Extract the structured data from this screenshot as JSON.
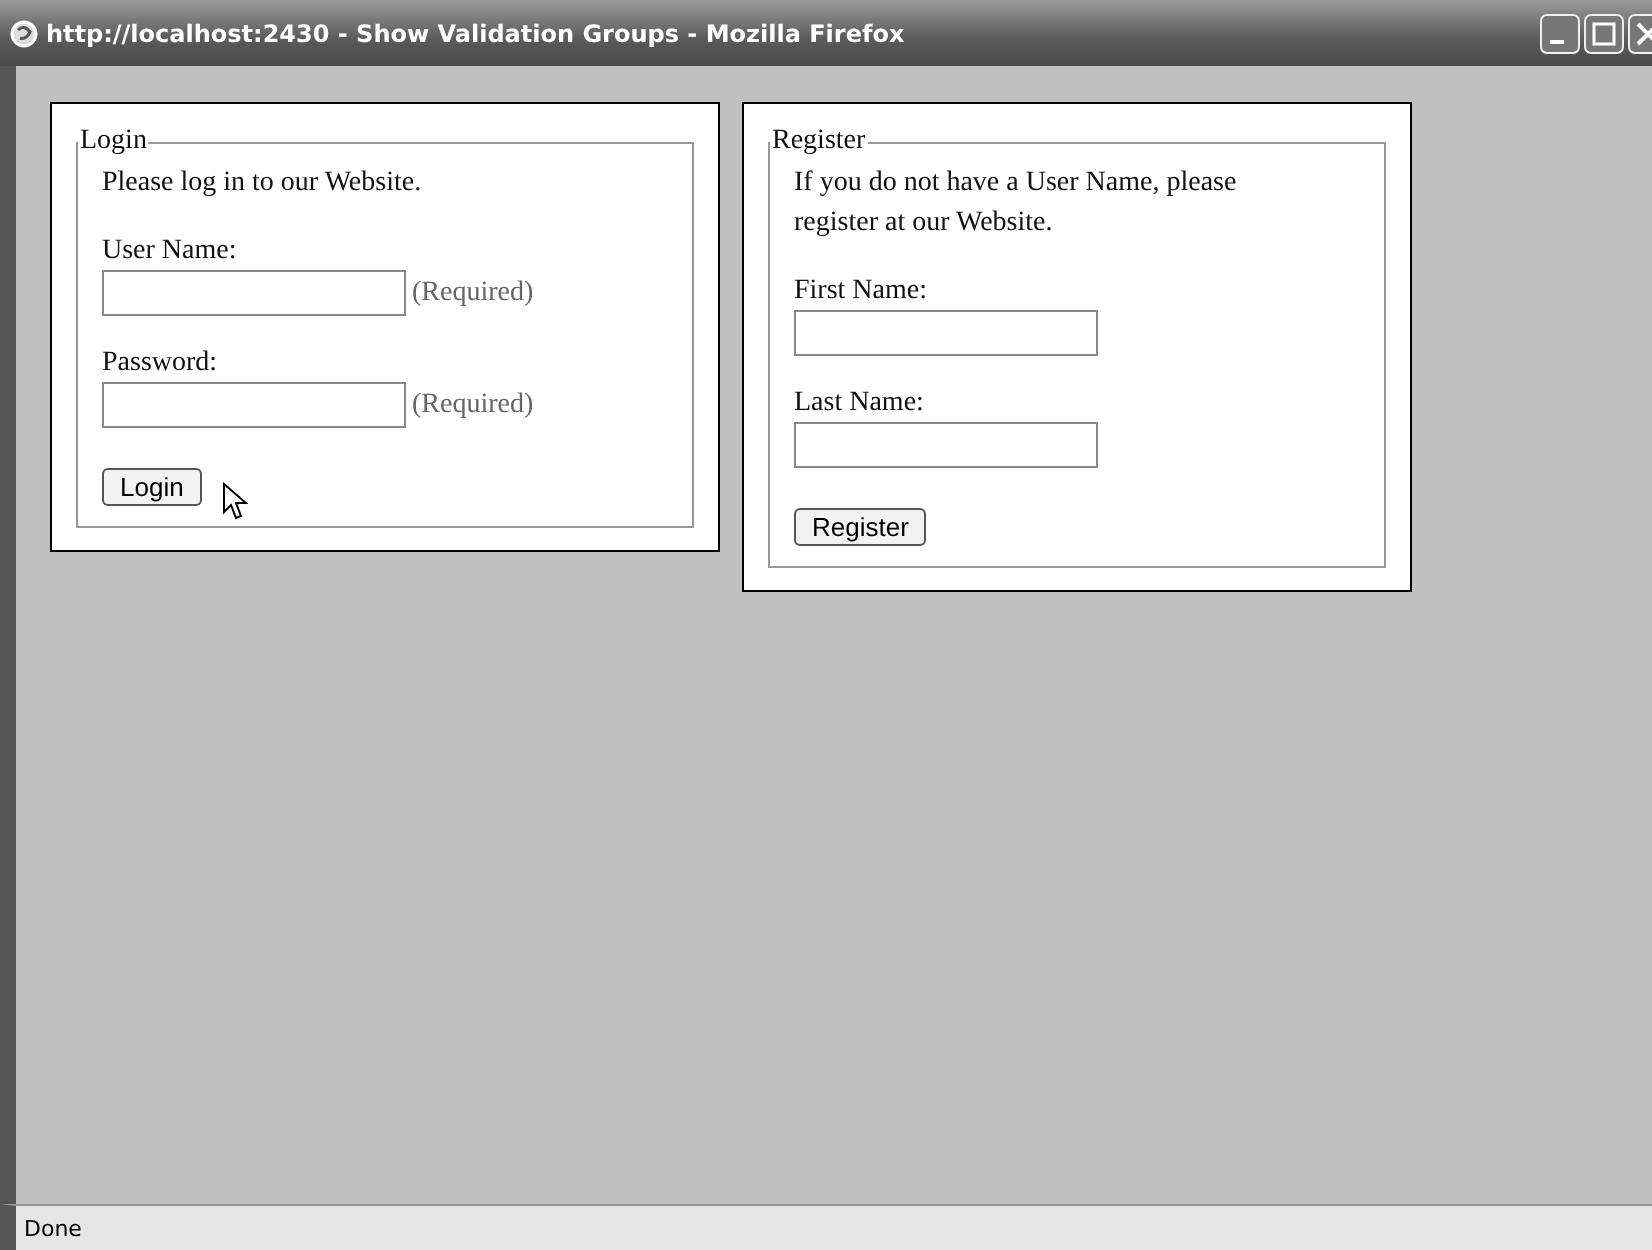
{
  "window": {
    "title": "http://localhost:2430 - Show Validation Groups - Mozilla Firefox"
  },
  "panels": [
    {
      "legend": "Login",
      "intro": "Please log in to our Website.",
      "fields": [
        {
          "label": "User Name:",
          "note": "(Required)"
        },
        {
          "label": "Password:",
          "note": "(Required)"
        }
      ],
      "button": {
        "label": "Login",
        "pointer": true
      }
    },
    {
      "legend": "Register",
      "intro": "If you do not have a User Name, please register at our Website.",
      "fields": [
        {
          "label": "First Name:"
        },
        {
          "label": "Last Name:"
        }
      ],
      "button": {
        "label": "Register",
        "pointer": false
      }
    }
  ],
  "status_bar": "Done"
}
